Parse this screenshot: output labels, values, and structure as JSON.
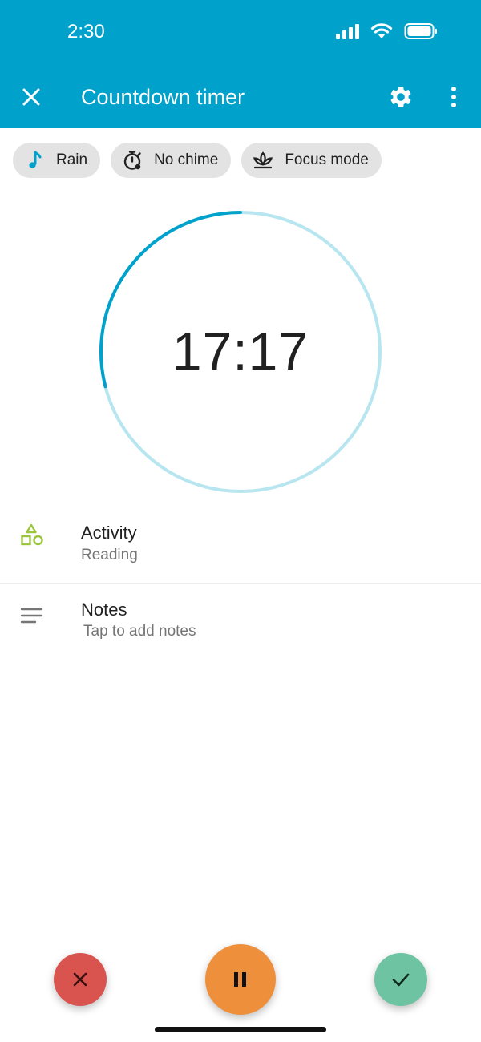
{
  "status_bar": {
    "time": "2:30"
  },
  "toolbar": {
    "title": "Countdown timer",
    "icons": [
      "close-icon",
      "gear-icon",
      "more-vert-icon"
    ]
  },
  "chips": [
    {
      "label": "Rain",
      "icon": "music-note-icon"
    },
    {
      "label": "No chime",
      "icon": "timer-off-icon"
    },
    {
      "label": "Focus mode",
      "icon": "lotus-icon"
    }
  ],
  "timer": {
    "display": "17:17",
    "progress_remaining": 0.29
  },
  "activity": {
    "title": "Activity",
    "value": "Reading",
    "icon": "shapes-icon"
  },
  "notes": {
    "title": "Notes",
    "placeholder": "Tap to add notes",
    "icon": "notes-lines-icon"
  },
  "actions": {
    "cancel_icon": "close-icon",
    "pause_icon": "pause-icon",
    "done_icon": "check-icon"
  },
  "colors": {
    "header": "#00A2CC",
    "ring_progress": "#00A2CC",
    "ring_track": "#B8E6F0",
    "chip_bg": "#E3E3E3",
    "activity_icon": "#9BC63C",
    "cancel": "#D9534F",
    "pause": "#EE8F3B",
    "done": "#6DC3A2"
  }
}
